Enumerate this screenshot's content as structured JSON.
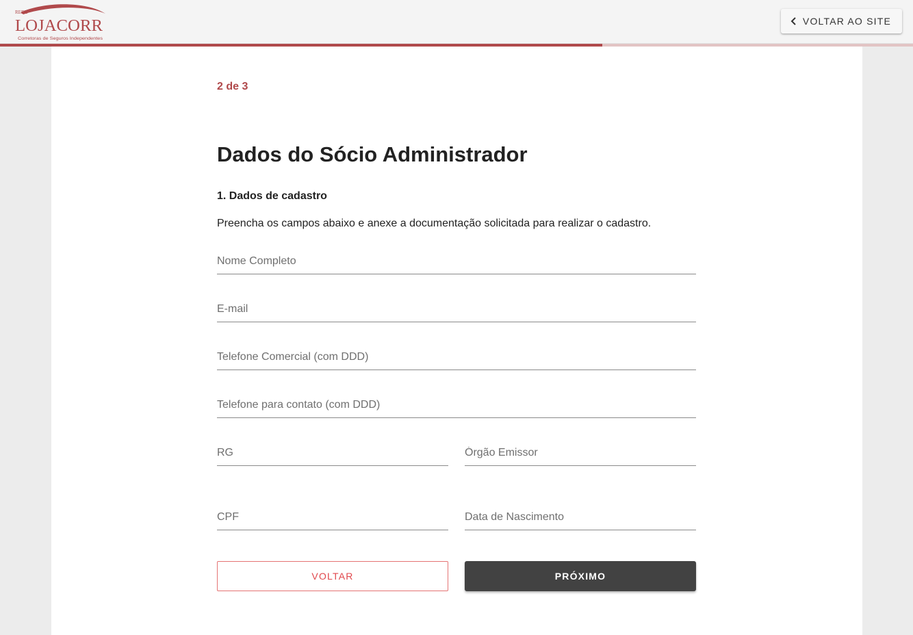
{
  "header": {
    "logo": {
      "top_text": "REDE",
      "brand": "LOJACORR",
      "tagline": "Corretoras de Seguros Independentes"
    },
    "back_to_site_label": "VOLTAR AO SITE",
    "back_icon": "chevron-left-icon"
  },
  "progress": {
    "fraction": 0.66
  },
  "form": {
    "step_label": "2 de 3",
    "title": "Dados do Sócio Administrador",
    "section_title": "1. Dados de cadastro",
    "description": "Preencha os campos abaixo e anexe a documentação solicitada para realizar o cadastro.",
    "fields": {
      "full_name": {
        "placeholder": "Nome Completo",
        "value": ""
      },
      "email": {
        "placeholder": "E-mail",
        "value": ""
      },
      "business_phone": {
        "placeholder": "Telefone Comercial (com DDD)",
        "value": ""
      },
      "contact_phone": {
        "placeholder": "Telefone para contato (com DDD)",
        "value": ""
      },
      "rg": {
        "placeholder": "RG",
        "value": ""
      },
      "issuer": {
        "placeholder": "Órgão Emissor",
        "value": ""
      },
      "cpf": {
        "placeholder": "CPF",
        "value": ""
      },
      "birth_date": {
        "placeholder": "Data de Nascimento",
        "value": ""
      }
    },
    "back_label": "VOLTAR",
    "next_label": "PRÓXIMO"
  },
  "colors": {
    "accent": "#b0494b",
    "accent_light": "#e2c4c4",
    "back_button": "#e0474c",
    "next_button_bg": "#424242",
    "page_bg": "#ececec",
    "card_bg": "#ffffff"
  }
}
